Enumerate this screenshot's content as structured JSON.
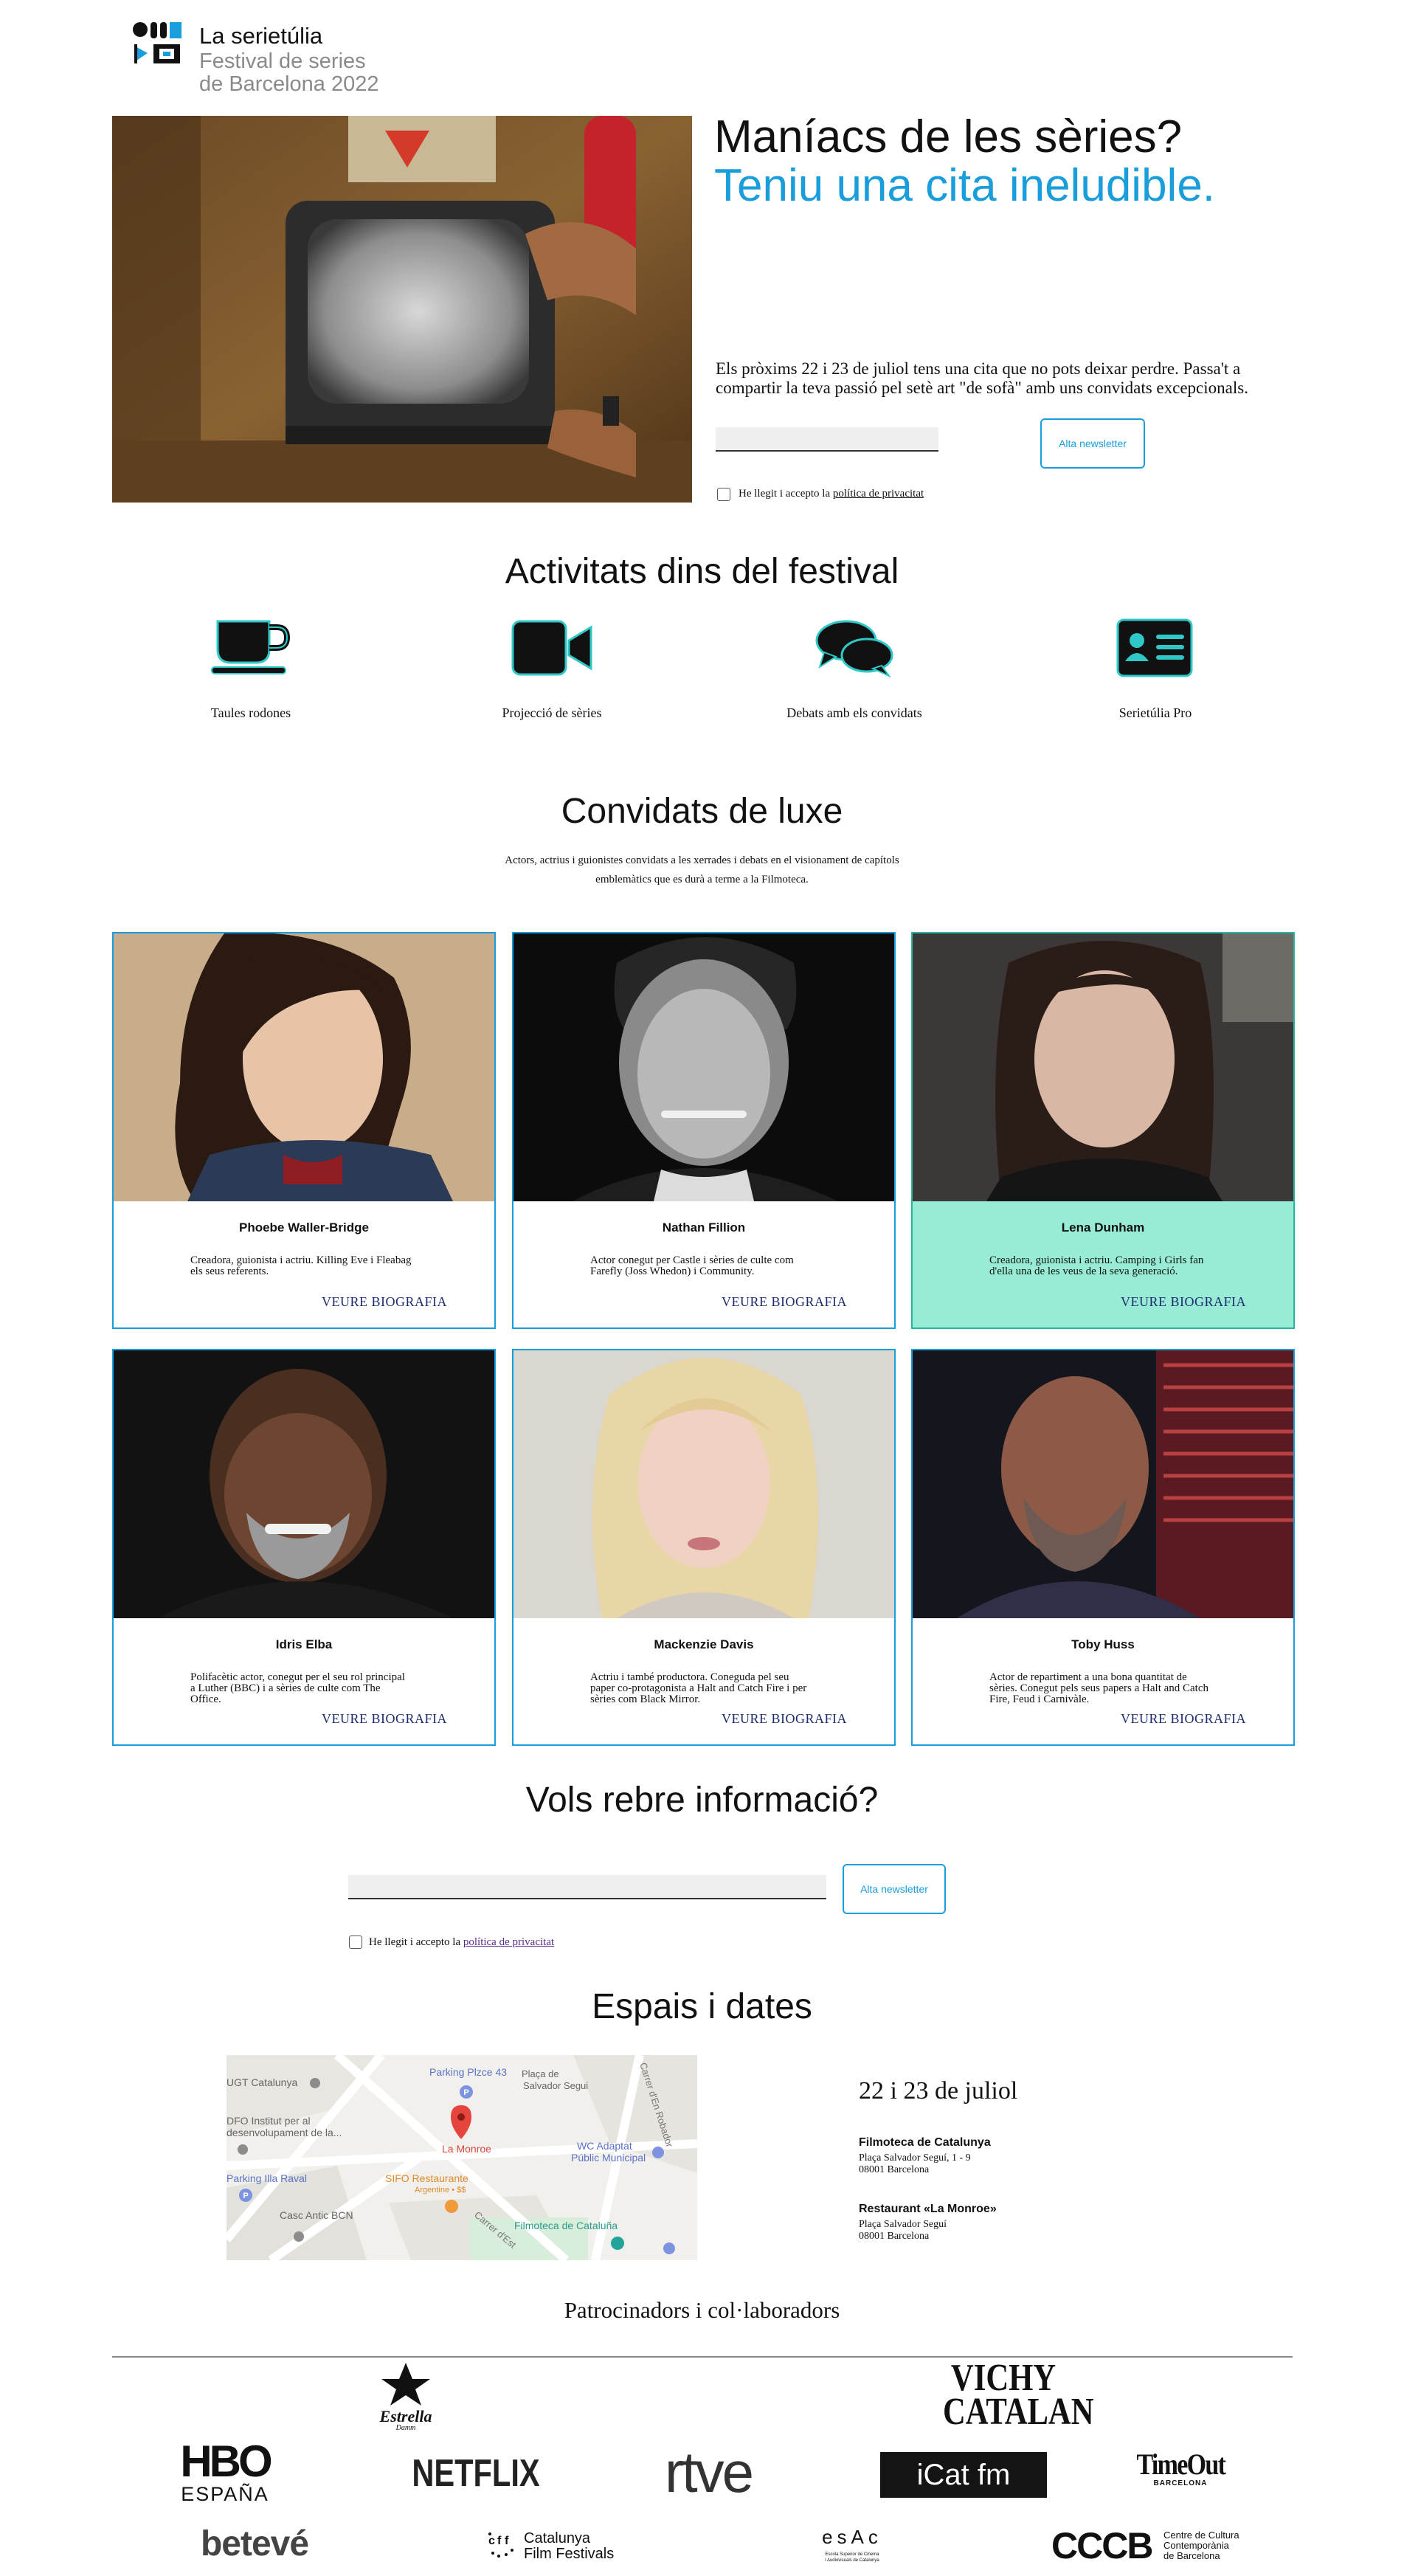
{
  "brand": {
    "title": "La serietúlia",
    "subtitle_line1": "Festival de series",
    "subtitle_line2": "de Barcelona 2022"
  },
  "hero": {
    "heading_line1": "Maníacs de les sèries?",
    "heading_line2": "Teniu una cita ineludible.",
    "description": "Els pròxims 22 i 23 de juliol tens una cita que no pots deixar perdre. Passa't a compartir la teva passió pel setè art \"de sofà\" amb uns convidats excepcionals.",
    "newsletter_button": "Alta newsletter",
    "privacy_prefix": "He llegit i accepto la ",
    "privacy_link": "política de privacitat"
  },
  "activities": {
    "heading": "Activitats dins del festival",
    "items": [
      {
        "label": "Taules rodones",
        "icon": "coffee-cup-icon"
      },
      {
        "label": "Projecció de sèries",
        "icon": "video-camera-icon"
      },
      {
        "label": "Debats amb els convidats",
        "icon": "chat-bubbles-icon"
      },
      {
        "label": "Serietúlia Pro",
        "icon": "id-card-icon"
      }
    ]
  },
  "guests": {
    "heading": "Convidats de luxe",
    "intro": "Actors, actrius i guionistes convidats a les xerrades i debats en el visionament de capítols emblemàtics que es durà a terme a la Filmoteca.",
    "more_label": "VEURE BIOGRAFIA",
    "items": [
      {
        "name": "Phoebe Waller-Bridge",
        "bio": "Creadora, guionista i actriu. Killing Eve i Fleabag els seus referents."
      },
      {
        "name": "Nathan Fillion",
        "bio": "Actor conegut per Castle i sèries de culte com Farefly (Joss Whedon) i Community."
      },
      {
        "name": "Lena Dunham",
        "bio": "Creadora, guionista i actriu. Camping i Girls fan d'ella una de les veus de la seva generació."
      },
      {
        "name": "Idris Elba",
        "bio": "Polifacètic actor, conegut per el seu rol principal a Luther (BBC) i a sèries de culte com The Office."
      },
      {
        "name": "Mackenzie Davis",
        "bio": "Actriu i també productora. Coneguda pel seu paper co-protagonista a Halt and Catch Fire i per sèries com Black Mirror."
      },
      {
        "name": "Toby Huss",
        "bio": "Actor de repartiment a una bona quantitat de sèries. Conegut pels seus papers a Halt and Catch Fire, Feud i Carnivàle."
      }
    ]
  },
  "info": {
    "heading": "Vols rebre informació?",
    "newsletter_button": "Alta newsletter",
    "privacy_prefix": "He llegit i accepto la ",
    "privacy_link": "política de privacitat"
  },
  "venues": {
    "heading": "Espais i dates",
    "date": "22 i 23 de juliol",
    "places": [
      {
        "name": "Filmoteca de Catalunya",
        "addr1": "Plaça Salvador Seguí, 1 - 9",
        "addr2": "08001 Barcelona"
      },
      {
        "name": "Restaurant «La Monroe»",
        "addr1": "Plaça Salvador Seguí",
        "addr2": "08001 Barcelona"
      }
    ],
    "map_labels": {
      "ugt": "UGT Catalunya",
      "parking1": "Parking Plzce 43",
      "placa1": "Plaça de",
      "placa2": "Salvador Segui",
      "carrer_robador": "Carrer d'En Robador",
      "dfo1": "DFO Institut per al",
      "dfo2": "desenvolupament de la...",
      "la_monroe": "La Monroe",
      "wc1": "WC Adaptat",
      "wc2": "Públic Municipal",
      "parking2": "Parking Illa Raval",
      "sifo1": "SIFO Restaurante",
      "sifo2": "Argentine • $$",
      "casc": "Casc Antic BCN",
      "carrer_est": "Carrer d'Est",
      "filmoteca": "Filmoteca de Cataluña"
    }
  },
  "sponsors": {
    "heading": "Patrocinadors i col·laboradors",
    "estrella_text": "Estrella",
    "estrella_sub": "Damm",
    "vichy_line1": "VICHY",
    "vichy_line2": "CATALAN",
    "hbo_text": "HBO",
    "hbo_sub": "ESPAÑA",
    "netflix_text": "NETFLIX",
    "rtve_text": "rtve",
    "icat_text": "iCat fm",
    "timeout_text": "TimeOut",
    "timeout_sub": "BARCELONA",
    "beteve_text": "betevé",
    "cff_line1": "Catalunya",
    "cff_line2": "Film Festivals",
    "esac_text": "esAc",
    "esac_sub1": "Escola Superior de Cinema",
    "esac_sub2": "i Audiovisuals de Catalunya",
    "cccb_text": "CCCB",
    "cccb_sub1": "Centre de Cultura",
    "cccb_sub2": "Contemporània",
    "cccb_sub3": "de Barcelona"
  },
  "colors": {
    "accent": "#1a9edb",
    "highlight": "#98ebd4",
    "icon_outline": "#2fc8c8"
  }
}
